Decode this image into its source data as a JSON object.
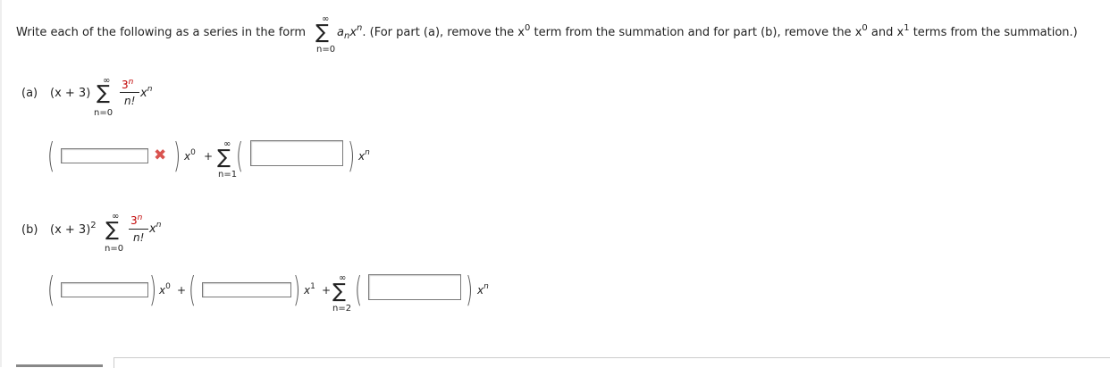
{
  "instruction": {
    "prefix": "Write each of the following as a series in the form",
    "a_n": "a",
    "n_sub": "n",
    "x": "x",
    "n_sup": "n",
    "middle": ". (For part (a), remove the x",
    "zero": "0",
    "middle2": " term from the summation and for part (b), remove the x",
    "and": " and x",
    "one": "1",
    "suffix": " terms from the summation.)",
    "sum_top": "∞",
    "sum_bottom": "n=0"
  },
  "part_a": {
    "label": "(a)",
    "factor": "(x + 3)",
    "sum_top": "∞",
    "sum_bottom": "n=0",
    "numerator": "3",
    "num_sup": "n",
    "denominator": "n!",
    "x_term": "x",
    "x_sup": "n",
    "answer_row": {
      "field1_value": "",
      "field1_status": "incorrect",
      "x0_label": "x",
      "x0_sup": "0",
      "plus": "+",
      "sum_top": "∞",
      "sum_bottom": "n=1",
      "field2_value": "",
      "xn_label": "x",
      "xn_sup": "n"
    }
  },
  "part_b": {
    "label": "(b)",
    "factor": "(x + 3)",
    "factor_sup": "2",
    "sum_top": "∞",
    "sum_bottom": "n=0",
    "numerator": "3",
    "num_sup": "n",
    "denominator": "n!",
    "x_term": "x",
    "x_sup": "n",
    "answer_row": {
      "field1_value": "",
      "x0_label": "x",
      "x0_sup": "0",
      "plus1": "+",
      "field2_value": "",
      "x1_label": "x",
      "x1_sup": "1",
      "plus2": "+",
      "sum_top": "∞",
      "sum_bottom": "n=2",
      "field3_value": "",
      "xn_label": "x",
      "xn_sup": "n"
    }
  },
  "colors": {
    "incorrect": "#d9534f",
    "text": "#222222",
    "field_border": "#7a7a7a"
  },
  "icons": {
    "incorrect_mark": "x-mark-icon"
  }
}
